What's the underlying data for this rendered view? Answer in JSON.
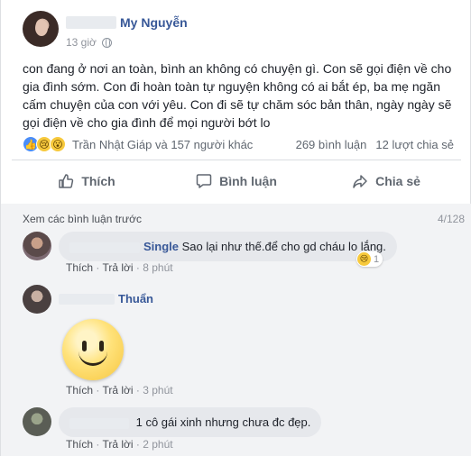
{
  "post": {
    "author": {
      "name": "My Nguyễn"
    },
    "time": "13 giờ",
    "privacy_icon": "globe-icon",
    "text": "con đang ở nơi an toàn, bình an không có chuyện gì. Con sẽ gọi điện về cho gia đình sớm. Con đi hoàn toàn tự nguyện không có ai bắt ép, ba mẹ ngăn cấm chuyện của con với yêu. Con đi sẽ tự chăm sóc bản thân, ngày ngày sẽ gọi điện về cho gia đình để mọi người bớt lo",
    "reactions": {
      "icons": [
        "like-reaction-icon",
        "sad-reaction-icon",
        "wow-reaction-icon"
      ],
      "summary": "Trần Nhật Giáp và 157 người khác",
      "comments_count": "269 bình luận",
      "shares_count": "12 lượt chia sẻ"
    },
    "actions": {
      "like": "Thích",
      "comment": "Bình luận",
      "share": "Chia sẻ"
    }
  },
  "comments": {
    "view_previous": "Xem các bình luận trước",
    "counter": "4/128",
    "items": [
      {
        "name": "Single",
        "text": "Sao lại như thế.để cho gd cháu lo lắng.",
        "like": "Thích",
        "reply": "Trả lời",
        "time": "8 phút",
        "reaction_count": "1"
      },
      {
        "name": "Thuẩn",
        "sticker": "smiley-sticker",
        "like": "Thích",
        "reply": "Trả lời",
        "time": "3 phút"
      },
      {
        "name": "",
        "text": "1 cô gái xinh nhưng chưa đc đẹp.",
        "like": "Thích",
        "reply": "Trả lời",
        "time": "2 phút"
      }
    ]
  },
  "colors": {
    "link": "#385898",
    "secondary_text": "#90949c",
    "comment_bubble": "#e6e8ec",
    "comments_bg": "#f2f3f5"
  }
}
